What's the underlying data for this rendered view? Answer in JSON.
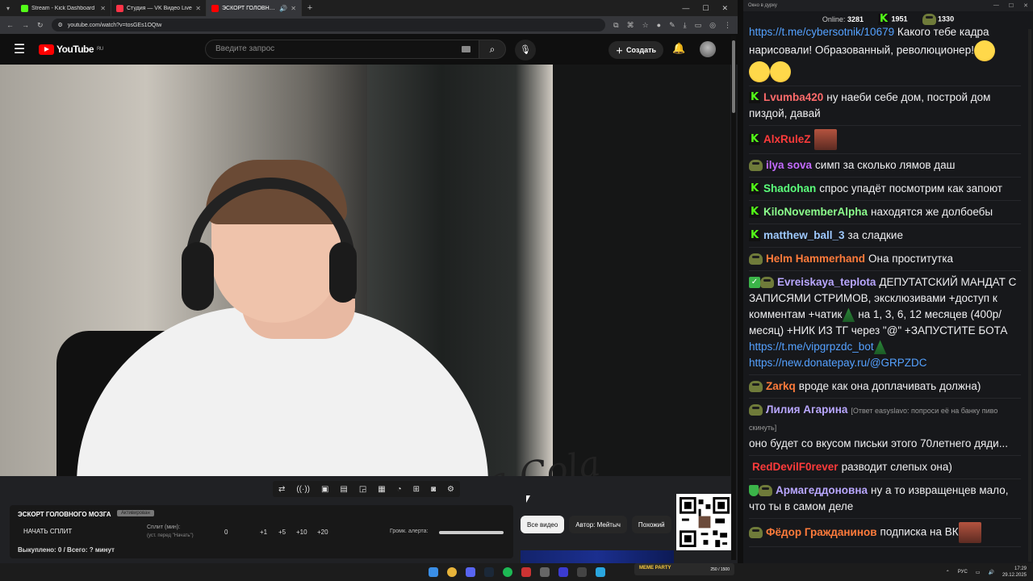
{
  "browser": {
    "tabs": [
      {
        "label": "Stream - Kick Dashboard",
        "color": "#53fc18"
      },
      {
        "label": "Студия — VK Видео Live",
        "color": "#ff3347"
      },
      {
        "label": "ЭСКОРТ ГОЛОВНОГО МОЗ...",
        "color": "#ff0000"
      }
    ],
    "url": "youtube.com/watch?v=tosGEs1OQtw"
  },
  "youtube": {
    "logo": "YouTube",
    "region": "RU",
    "search_placeholder": "Введите запрос",
    "create_label": "Создать"
  },
  "dashboard": {
    "title": "ЭСКОРТ ГОЛОВНОГО МОЗГА",
    "badge": "Активирован",
    "split_button": "НАЧАТЬ СПЛИТ",
    "split_label": "Сплит (мин):",
    "split_hint": "(уст. перед \"Начать\")",
    "split_value": "0",
    "increments": [
      "+1",
      "+5",
      "+10",
      "+20"
    ],
    "volume_label": "Громк. алерта:",
    "volume_level": 1.0,
    "bought": "Выкуплено: 0 / Всего: ? минут"
  },
  "video_overlay_text": "Enjoy Coca-Cola",
  "chips": [
    "Все видео",
    "Автор: Мейтыч",
    "Похожий"
  ],
  "chat": {
    "window_title": "Окно в дурку",
    "online_label": "Online:",
    "online": "3281",
    "kick_count": "1951",
    "other_count": "1330",
    "messages": [
      {
        "badge": "none",
        "nick": "",
        "color": "#ffffff",
        "link": "https://t.me/cybersotnik/10679",
        "text": " Какого тебе кадра нарисовали! Образованный, революционер!",
        "emoji": "laugh3"
      },
      {
        "badge": "kick",
        "nick": "Lvumba420",
        "color": "#ff6b6b",
        "text": "ну наеби себе дом, построй дом пиздой, давай"
      },
      {
        "badge": "kick",
        "nick": "AlxRuleZ",
        "color": "#ff3b3b",
        "text": "",
        "emoji": "photo"
      },
      {
        "badge": "pepe",
        "nick": "ilya sova",
        "color": "#c46bff",
        "text": "симп за сколько лямов даш"
      },
      {
        "badge": "kick",
        "nick": "Shadohan",
        "color": "#5bff7b",
        "text": "спрос упадёт посмотрим как запоют"
      },
      {
        "badge": "kick",
        "nick": "KiloNovemberAlpha",
        "color": "#8cff8c",
        "text": "находятся же долбоебы"
      },
      {
        "badge": "kick",
        "nick": "matthew_ball_3",
        "color": "#9ec9ff",
        "text": "за сладкие"
      },
      {
        "badge": "pepe",
        "nick": "Helm Hammerhand",
        "color": "#ff7b3b",
        "text": "Она проститутка"
      },
      {
        "badge": "checkpepe",
        "nick": "Evreiskaya_teplota",
        "color": "#b9a7ff",
        "text": "ДЕПУТАТСКИЙ МАНДАТ С ЗАПИСЯМИ СТРИМОВ, эксклюзивами +доступ к комментам +чатик",
        "text2": " на 1, 3, 6, 12 месяцев (400р/месяц) +НИК ИЗ ТГ через \"@\" +ЗАПУСТИТЕ БОТА ",
        "link": "https://t.me/vipgrpzdc_bot",
        "link2": "https://new.donatepay.ru/@GRPZDC"
      },
      {
        "badge": "pepe",
        "nick": "Zarkq",
        "color": "#ff7b3b",
        "text": "вроде как она доплачивать должна)"
      },
      {
        "badge": "pepe",
        "nick": "Лилия Агарина",
        "color": "#b9a7ff",
        "reply": "[Ответ easyslavo: попроси её на банку пиво скинуть]",
        "text": "оно будет со вкусом письки этого 70летнего дяди..."
      },
      {
        "badge": "none",
        "nick": "RedDevilF0rever",
        "color": "#ff3b3b",
        "text": "разводит слепых она)"
      },
      {
        "badge": "shieldpepe",
        "nick": "Армагеддоновна",
        "color": "#b9a7ff",
        "text": "ну а то извращенцев мало, что ты в самом деле"
      },
      {
        "badge": "pepe",
        "nick": "Фёдор Гражданинов",
        "color": "#ff7b3b",
        "text": "подписка на ВК",
        "emoji": "photo"
      }
    ]
  },
  "taskbar": {
    "media_label": "MEME PARTY",
    "media_counter": "250 / 1500",
    "lang": "РУС",
    "time": "17:29",
    "date": "29.12.2025"
  }
}
